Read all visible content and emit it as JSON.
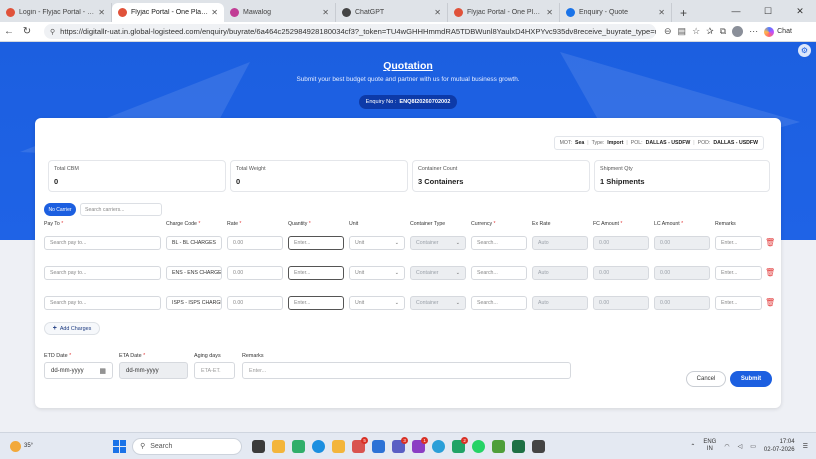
{
  "browser": {
    "tabs": [
      {
        "label": "Login - Flyjac Portal - One Pla",
        "color": "#e0523a",
        "active": false
      },
      {
        "label": "Flyjac Portal - One Place for A",
        "color": "#e0523a",
        "active": true
      },
      {
        "label": "Mawalog",
        "color": "#c13d95",
        "active": false
      },
      {
        "label": "ChatGPT",
        "color": "#444444",
        "active": false
      },
      {
        "label": "Flyjac Portal - One Place for A",
        "color": "#e0523a",
        "active": false
      },
      {
        "label": "Enquiry - Quote",
        "color": "#1a73e8",
        "active": false
      }
    ],
    "url": "https://digitallr-uat.in.global-logisteed.com/enquiry/buyrate/6a464c252984928180034cf3?_token=TU4wGHHHmmdRA5TDBWunl8YaulxD4HXPYvc935dv8receive_buyrate_type=ma...",
    "chat_label": "Chat"
  },
  "hero": {
    "title": "Quotation",
    "subtitle": "Submit your best budget quote and partner with us for mutual business growth.",
    "enquiry_label": "Enquiry No :",
    "enquiry_no": "ENQ8I20260702002"
  },
  "meta": {
    "mot_label": "MOT:",
    "mot": "Sea",
    "type_label": "Type:",
    "type": "Import",
    "pol_label": "POL:",
    "pol": "DALLAS - USDFW",
    "pod_label": "POD:",
    "pod": "DALLAS - USDFW"
  },
  "stats": [
    {
      "label": "Total CBM",
      "value": "0"
    },
    {
      "label": "Total Weight",
      "value": "0"
    },
    {
      "label": "Container Count",
      "value": "3 Containers"
    },
    {
      "label": "Shipment Qty",
      "value": "1 Shipments"
    }
  ],
  "carrier": {
    "button_label": "No Carrier",
    "search_placeholder": "Search carriers..."
  },
  "columns": {
    "pay_to": "Pay To",
    "charge_code": "Charge Code",
    "rate": "Rate",
    "quantity": "Quantity",
    "unit": "Unit",
    "container_type": "Container Type",
    "currency": "Currency",
    "ex_rate": "Ex Rate",
    "fc_amount": "FC Amount",
    "lc_amount": "LC Amount",
    "remarks": "Remarks"
  },
  "placeholders": {
    "pay_to": "Search pay to...",
    "rate": "0.00",
    "quantity": "Enter...",
    "unit": "Unit",
    "container": "Container",
    "currency": "Search...",
    "ex_rate": "Auto",
    "fc": "0.00",
    "lc": "0.00",
    "remarks": "Enter..."
  },
  "rows": [
    {
      "charge_code": "BL - BL CHARGES"
    },
    {
      "charge_code": "ENS - ENS CHARGE"
    },
    {
      "charge_code": "ISPS - ISPS CHARGE"
    }
  ],
  "add_charges_label": "Add Charges",
  "bottom": {
    "etd_label": "ETD Date",
    "etd_value": "dd-mm-yyyy",
    "eta_label": "ETA Date",
    "eta_value": "dd-mm-yyyy",
    "aging_label": "Aging days",
    "aging_placeholder": "ETA-ET.",
    "remarks_label": "Remarks",
    "remarks_placeholder": "Enter...",
    "cancel_label": "Cancel",
    "submit_label": "Submit"
  },
  "taskbar": {
    "temp": "35°",
    "search_placeholder": "Search",
    "lang_1": "ENG",
    "lang_2": "IN",
    "time": "17:04",
    "date": "02-07-2026"
  },
  "colors": {
    "primary": "#1c5fe0",
    "danger": "#e23b3b"
  }
}
